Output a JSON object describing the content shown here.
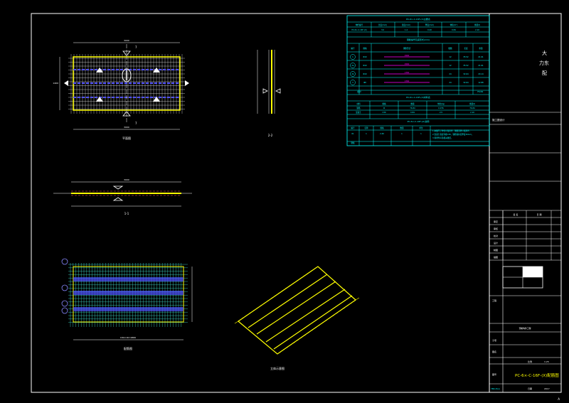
{
  "colors": {
    "background": "#000000",
    "frame": "#ffffff",
    "table_line": "#00ffff",
    "yellow": "#ffff00",
    "magenta": "#ff00ff",
    "rebar_blue": "#5050ff",
    "rebar_cyan": "#40e0d0",
    "white": "#ffffff"
  },
  "views": {
    "plan_label": "平面图",
    "section_22_label": "2-2",
    "section_11_label": "1-1",
    "rebar_plan_label": "配筋图",
    "iso_label": "立体示意图",
    "plan_dim_top": "3000",
    "plan_dim_bottom": "3000",
    "plan_dim_left": "1400",
    "section_dim": "3000",
    "rebar_dim_bottom": "180×16=2880",
    "cut_mark": "7"
  },
  "rebar_table": {
    "title": "PC-6×-C-16F-(X)主要表",
    "header": [
      "构件编号",
      "长度(mm)",
      "宽度(mm)",
      "厚度(mm)",
      "体积(m³)",
      "重量(t)"
    ],
    "row1": [
      "PC-6×-C-16F-(X)",
      "3.0",
      "1.4",
      "0.20",
      "0.84",
      "2.10"
    ],
    "steel_title": "钢筋编号及其形式(mm)",
    "steel_header": [
      "编号",
      "规格",
      "钢筋形式",
      "根数",
      "长度",
      "重量"
    ],
    "steel_rows": [
      [
        "1",
        "Φ10",
        "2960",
        "12",
        "35.52",
        "21.91"
      ],
      [
        "2a",
        "Φ10",
        "2960",
        "12",
        "35.52",
        "21.91"
      ],
      [
        "2b",
        "Φ10",
        "1360",
        "24",
        "32.64",
        "20.14"
      ],
      [
        "3",
        "Φ8",
        "1360",
        "24",
        "32.64",
        "12.88"
      ]
    ],
    "total_label": "合计",
    "total_value": "76.84",
    "mat_title": "PC-6×-C-16F-(X)材料表",
    "mat_header": [
      "材料",
      "规格",
      "数量",
      "单重(kg)",
      "重量(t)"
    ],
    "mat_rows": [
      [
        "钢筋",
        "Φ",
        "76.84",
        "0.076",
        "76.84"
      ],
      [
        "混凝土",
        "C30",
        "0.84",
        "2.5",
        "2.10"
      ]
    ],
    "note_title": "PC-6×-C-16F-(X)说明",
    "note_header": [
      "编号",
      "名称",
      "规格",
      "数量",
      "单位",
      "备注"
    ],
    "note_row": [
      "01",
      "1",
      "2.40",
      "1",
      "1",
      "1"
    ],
    "note_text_1": "1.本图尺寸单位以毫米计，钢筋直径以毫米计。",
    "note_text_2": "2.混凝土强度等级C30，钢筋保护层厚度30mm。",
    "note_text_3": "3.预埋件详见相关图纸。",
    "note_row2": [
      "钢板",
      "",
      "",
      "",
      "",
      ""
    ]
  },
  "title_block": {
    "company": "大\n力东\n配",
    "design_stage": "施工图设计",
    "row_labels": [
      "审定",
      "审核",
      "校对",
      "设计",
      "制图",
      "描图"
    ],
    "col_labels": [
      "签 名",
      "日 期"
    ],
    "project_label": "工程",
    "project_name": "预制构件工程",
    "sub_label": "子项",
    "drawing_title_label": "图名",
    "scale_label": "比例",
    "scale_value": "1:25",
    "drawing_no_label": "图号",
    "drawing_name": "PC-6×-C-16F-(X)配筋图",
    "date_label": "日期",
    "date_value": "2017",
    "sheet_no": "YBC-M-A",
    "page_mark": "A"
  }
}
